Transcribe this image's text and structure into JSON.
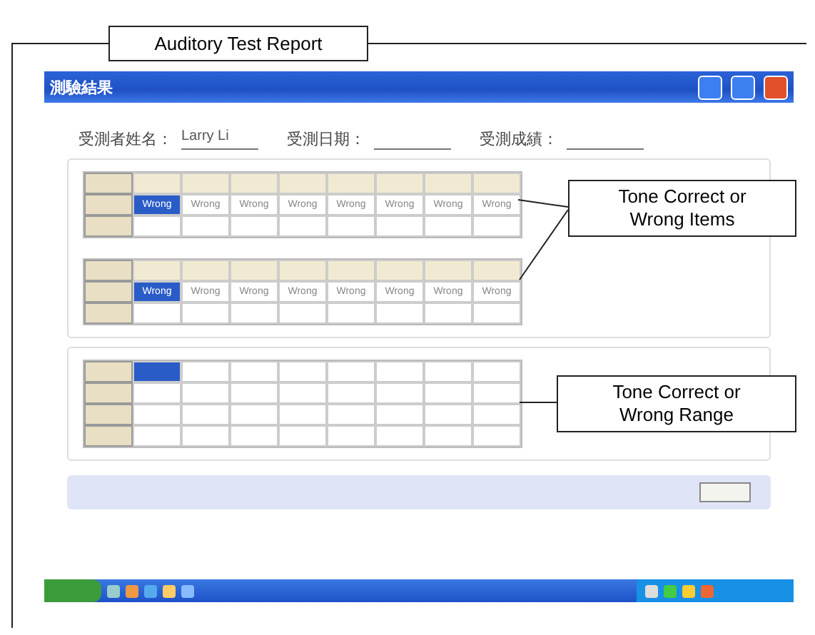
{
  "figure_title": "Auditory Test Report",
  "window": {
    "title": "測驗結果"
  },
  "info": [
    {
      "label": "受測者姓名：",
      "value": "Larry Li"
    },
    {
      "label": "受測日期："
    },
    {
      "label": "受測成績："
    }
  ],
  "item_tables": [
    {
      "rows": [
        {
          "cells": [
            {
              "selected": false
            },
            {
              "selected": false
            },
            {
              "selected": false
            },
            {
              "selected": false
            },
            {
              "selected": false
            },
            {
              "selected": false
            },
            {
              "selected": false
            },
            {
              "selected": false
            }
          ]
        },
        {
          "cells": [
            {
              "text": "Wrong",
              "selected": true
            },
            {
              "text": "Wrong",
              "selected": false
            },
            {
              "text": "Wrong",
              "selected": false
            },
            {
              "text": "Wrong",
              "selected": false
            },
            {
              "text": "Wrong",
              "selected": false
            },
            {
              "text": "Wrong",
              "selected": false
            },
            {
              "text": "Wrong",
              "selected": false
            },
            {
              "text": "Wrong",
              "selected": false
            }
          ]
        },
        {
          "cells": []
        }
      ]
    },
    {
      "rows": [
        {
          "cells": [
            {
              "selected": false
            },
            {
              "selected": false
            },
            {
              "selected": false
            },
            {
              "selected": false
            },
            {
              "selected": false
            },
            {
              "selected": false
            },
            {
              "selected": false
            },
            {
              "selected": false
            }
          ]
        },
        {
          "cells": [
            {
              "text": "Wrong",
              "selected": true
            },
            {
              "text": "Wrong",
              "selected": false
            },
            {
              "text": "Wrong",
              "selected": false
            },
            {
              "text": "Wrong",
              "selected": false
            },
            {
              "text": "Wrong",
              "selected": false
            },
            {
              "text": "Wrong",
              "selected": false
            },
            {
              "text": "Wrong",
              "selected": false
            },
            {
              "text": "Wrong",
              "selected": false
            }
          ]
        },
        {
          "cells": []
        }
      ]
    }
  ],
  "range_table": {
    "rows": [
      {
        "cells": [
          {
            "selected": true
          },
          {
            "selected": false
          },
          {
            "selected": false
          },
          {
            "selected": false
          },
          {
            "selected": false
          },
          {
            "selected": false
          },
          {
            "selected": false
          },
          {
            "selected": false
          }
        ]
      },
      {
        "cells": []
      },
      {
        "cells": [
          {
            "selected": false
          },
          {
            "selected": false
          },
          {
            "selected": false
          },
          {
            "selected": false
          },
          {
            "selected": false
          },
          {
            "selected": false
          },
          {
            "selected": false
          }
        ]
      },
      {
        "cells": []
      }
    ]
  },
  "callouts": [
    {
      "text": "Tone Correct or Wrong Items",
      "kind": "items"
    },
    {
      "text": "Tone Correct or Wrong Range",
      "kind": "range"
    }
  ]
}
